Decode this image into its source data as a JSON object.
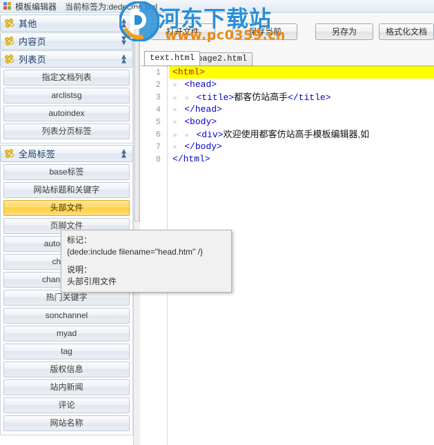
{
  "titlebar": {
    "icon": "app-grid-icon",
    "title": "模板编辑器",
    "subtitle": "当前标签为:dedecms.xml"
  },
  "sidebar": {
    "sections": [
      {
        "label": "其他",
        "icon": "flower-icon",
        "chevron": "chevron-up-double-icon",
        "expanded": false,
        "items": []
      },
      {
        "label": "内容页",
        "icon": "flower-icon",
        "chevron": "chevron-down-double-icon",
        "expanded": false,
        "items": []
      },
      {
        "label": "列表页",
        "icon": "flower-icon",
        "chevron": "chevron-up-double-icon",
        "expanded": true,
        "items": [
          {
            "label": "指定文档列表",
            "selected": false
          },
          {
            "label": "arclistsg",
            "selected": false
          },
          {
            "label": "autoindex",
            "selected": false
          },
          {
            "label": "列表分页标签",
            "selected": false
          }
        ]
      },
      {
        "label": "全局标签",
        "icon": "flower-icon",
        "chevron": "chevron-up-double-icon",
        "expanded": true,
        "items": [
          {
            "label": "base标签",
            "selected": false
          },
          {
            "label": "网站标题和关键字",
            "selected": false
          },
          {
            "label": "头部文件",
            "selected": true
          },
          {
            "label": "页脚文件",
            "selected": false
          },
          {
            "label": "autochannel",
            "selected": false
          },
          {
            "label": "channel",
            "selected": false
          },
          {
            "label": "channelartlist",
            "selected": false
          },
          {
            "label": "热门关键字",
            "selected": false
          },
          {
            "label": "sonchannel",
            "selected": false
          },
          {
            "label": "myad",
            "selected": false
          },
          {
            "label": "tag",
            "selected": false
          },
          {
            "label": "版权信息",
            "selected": false
          },
          {
            "label": "站内新闻",
            "selected": false
          },
          {
            "label": "评论",
            "selected": false
          },
          {
            "label": "网站名称",
            "selected": false
          }
        ]
      }
    ]
  },
  "tooltip": {
    "mark_label": "标记：",
    "mark_value": "{dede:include filename=\"head.htm\" /}",
    "desc_label": "说明：",
    "desc_value": "头部引用文件"
  },
  "toolbar": {
    "open_label": "打开文件",
    "save_label": "保存当前",
    "saveas_label": "另存为",
    "format_label": "格式化文档"
  },
  "watermark": {
    "brand": "河东下载站",
    "url": "www.pc0359.cn",
    "brand_color": "#2a8fd6",
    "url_color": "#e98b14"
  },
  "editor": {
    "tabs": [
      {
        "label": "text.html",
        "active": true
      },
      {
        "label": "page2.html",
        "active": false
      }
    ],
    "highlight_color": "#ffff00",
    "lines": [
      {
        "num": "1",
        "indent": 0,
        "guides": 0,
        "text": "<html>",
        "highlight": true
      },
      {
        "num": "2",
        "indent": 1,
        "guides": 1,
        "text": "<head>",
        "highlight": false
      },
      {
        "num": "3",
        "indent": 2,
        "guides": 2,
        "text": "<title>都客仿站高手</title>",
        "highlight": false
      },
      {
        "num": "4",
        "indent": 1,
        "guides": 1,
        "text": "</head>",
        "highlight": false
      },
      {
        "num": "5",
        "indent": 1,
        "guides": 1,
        "text": "<body>",
        "highlight": false
      },
      {
        "num": "6",
        "indent": 2,
        "guides": 2,
        "text": "<div>欢迎使用都客仿站高手模板编辑器,如",
        "highlight": false
      },
      {
        "num": "7",
        "indent": 1,
        "guides": 1,
        "text": "</body>",
        "highlight": false
      },
      {
        "num": "8",
        "indent": 0,
        "guides": 0,
        "text": "</html>",
        "highlight": false
      }
    ]
  }
}
